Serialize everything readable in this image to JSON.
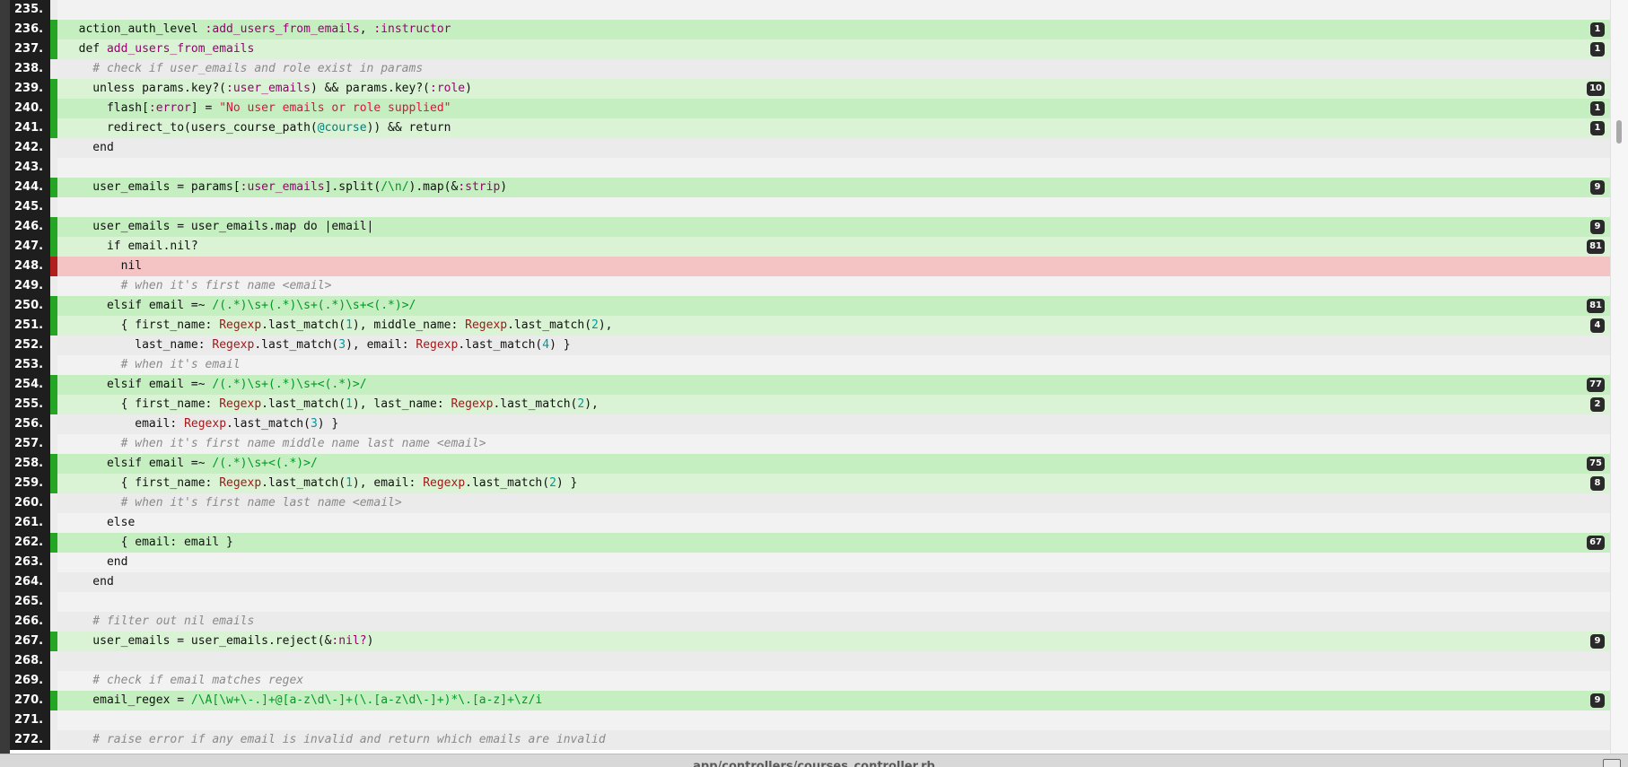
{
  "file": {
    "path": "app/controllers/courses_controller.rb"
  },
  "colors": {
    "covered_mark": "#24a624",
    "missed_mark": "#b01e1e",
    "covered_bg": "#d9f3d4",
    "missed_bg": "#f4c3c3",
    "gutter_bg": "#1e1e1e"
  },
  "lines": [
    {
      "num": "235.",
      "status": "never",
      "hits": null,
      "tokens": []
    },
    {
      "num": "236.",
      "status": "covered",
      "hits": "1",
      "tokens": [
        [
          "",
          "  action_auth_level "
        ],
        [
          "sym",
          ":add_users_from_emails"
        ],
        [
          "",
          ", "
        ],
        [
          "sym",
          ":instructor"
        ]
      ]
    },
    {
      "num": "237.",
      "status": "covered",
      "hits": "1",
      "tokens": [
        [
          "",
          "  def "
        ],
        [
          "sym",
          "add_users_from_emails"
        ]
      ]
    },
    {
      "num": "238.",
      "status": "never",
      "hits": null,
      "tokens": [
        [
          "com",
          "    # check if user_emails and role exist in params"
        ]
      ]
    },
    {
      "num": "239.",
      "status": "covered",
      "hits": "10",
      "tokens": [
        [
          "",
          "    unless params.key?("
        ],
        [
          "sym",
          ":user_emails"
        ],
        [
          "",
          ") && params.key?("
        ],
        [
          "sym",
          ":role"
        ],
        [
          "",
          ")"
        ]
      ]
    },
    {
      "num": "240.",
      "status": "covered",
      "hits": "1",
      "tokens": [
        [
          "",
          "      flash["
        ],
        [
          "sym",
          ":error"
        ],
        [
          "",
          "] = "
        ],
        [
          "str",
          "\"No user emails or role supplied\""
        ]
      ]
    },
    {
      "num": "241.",
      "status": "covered",
      "hits": "1",
      "tokens": [
        [
          "",
          "      redirect_to(users_course_path("
        ],
        [
          "ivar",
          "@course"
        ],
        [
          "",
          "))"
        ],
        [
          "",
          " && return"
        ]
      ]
    },
    {
      "num": "242.",
      "status": "never",
      "hits": null,
      "tokens": [
        [
          "",
          "    end"
        ]
      ]
    },
    {
      "num": "243.",
      "status": "never",
      "hits": null,
      "tokens": []
    },
    {
      "num": "244.",
      "status": "covered",
      "hits": "9",
      "tokens": [
        [
          "",
          "    user_emails = params["
        ],
        [
          "sym",
          ":user_emails"
        ],
        [
          "",
          "].split("
        ],
        [
          "re",
          "/\\n/"
        ],
        [
          "",
          ").map(&"
        ],
        [
          "sym",
          ":strip"
        ],
        [
          "",
          ")"
        ]
      ]
    },
    {
      "num": "245.",
      "status": "never",
      "hits": null,
      "tokens": []
    },
    {
      "num": "246.",
      "status": "covered",
      "hits": "9",
      "tokens": [
        [
          "",
          "    user_emails = user_emails.map do |email|"
        ]
      ]
    },
    {
      "num": "247.",
      "status": "covered",
      "hits": "81",
      "tokens": [
        [
          "",
          "      if email.nil?"
        ]
      ]
    },
    {
      "num": "248.",
      "status": "missed",
      "hits": null,
      "tokens": [
        [
          "",
          "        nil"
        ]
      ]
    },
    {
      "num": "249.",
      "status": "never",
      "hits": null,
      "tokens": [
        [
          "com",
          "        # when it's first name <email>"
        ]
      ]
    },
    {
      "num": "250.",
      "status": "covered",
      "hits": "81",
      "tokens": [
        [
          "",
          "      elsif email =~ "
        ],
        [
          "re",
          "/(.*)\\s+(.*)\\s+(.*)\\s+<(.*)>/"
        ]
      ]
    },
    {
      "num": "251.",
      "status": "covered",
      "hits": "4",
      "tokens": [
        [
          "",
          "        { first_name: "
        ],
        [
          "const",
          "Regexp"
        ],
        [
          "",
          ".last_match("
        ],
        [
          "num",
          "1"
        ],
        [
          "",
          "), middle_name: "
        ],
        [
          "const",
          "Regexp"
        ],
        [
          "",
          ".last_match("
        ],
        [
          "num",
          "2"
        ],
        [
          "",
          "),"
        ]
      ]
    },
    {
      "num": "252.",
      "status": "never",
      "hits": null,
      "tokens": [
        [
          "",
          "          last_name: "
        ],
        [
          "const",
          "Regexp"
        ],
        [
          "",
          ".last_match("
        ],
        [
          "num",
          "3"
        ],
        [
          "",
          "), email: "
        ],
        [
          "const",
          "Regexp"
        ],
        [
          "",
          ".last_match("
        ],
        [
          "num",
          "4"
        ],
        [
          "",
          ") }"
        ]
      ]
    },
    {
      "num": "253.",
      "status": "never",
      "hits": null,
      "tokens": [
        [
          "com",
          "        # when it's email"
        ]
      ]
    },
    {
      "num": "254.",
      "status": "covered",
      "hits": "77",
      "tokens": [
        [
          "",
          "      elsif email =~ "
        ],
        [
          "re",
          "/(.*)\\s+(.*)\\s+<(.*)>/"
        ]
      ]
    },
    {
      "num": "255.",
      "status": "covered",
      "hits": "2",
      "tokens": [
        [
          "",
          "        { first_name: "
        ],
        [
          "const",
          "Regexp"
        ],
        [
          "",
          ".last_match("
        ],
        [
          "num",
          "1"
        ],
        [
          "",
          "), last_name: "
        ],
        [
          "const",
          "Regexp"
        ],
        [
          "",
          ".last_match("
        ],
        [
          "num",
          "2"
        ],
        [
          "",
          "),"
        ]
      ]
    },
    {
      "num": "256.",
      "status": "never",
      "hits": null,
      "tokens": [
        [
          "",
          "          email: "
        ],
        [
          "const",
          "Regexp"
        ],
        [
          "",
          ".last_match("
        ],
        [
          "num",
          "3"
        ],
        [
          "",
          ") }"
        ]
      ]
    },
    {
      "num": "257.",
      "status": "never",
      "hits": null,
      "tokens": [
        [
          "com",
          "        # when it's first name middle name last name <email>"
        ]
      ]
    },
    {
      "num": "258.",
      "status": "covered",
      "hits": "75",
      "tokens": [
        [
          "",
          "      elsif email =~ "
        ],
        [
          "re",
          "/(.*)\\s+<(.*)>/"
        ]
      ]
    },
    {
      "num": "259.",
      "status": "covered",
      "hits": "8",
      "tokens": [
        [
          "",
          "        { first_name: "
        ],
        [
          "const",
          "Regexp"
        ],
        [
          "",
          ".last_match("
        ],
        [
          "num",
          "1"
        ],
        [
          "",
          "), email: "
        ],
        [
          "const",
          "Regexp"
        ],
        [
          "",
          ".last_match("
        ],
        [
          "num",
          "2"
        ],
        [
          "",
          ") }"
        ]
      ]
    },
    {
      "num": "260.",
      "status": "never",
      "hits": null,
      "tokens": [
        [
          "com",
          "        # when it's first name last name <email>"
        ]
      ]
    },
    {
      "num": "261.",
      "status": "never",
      "hits": null,
      "tokens": [
        [
          "",
          "      else"
        ]
      ]
    },
    {
      "num": "262.",
      "status": "covered",
      "hits": "67",
      "tokens": [
        [
          "",
          "        { email: email }"
        ]
      ]
    },
    {
      "num": "263.",
      "status": "never",
      "hits": null,
      "tokens": [
        [
          "",
          "      end"
        ]
      ]
    },
    {
      "num": "264.",
      "status": "never",
      "hits": null,
      "tokens": [
        [
          "",
          "    end"
        ]
      ]
    },
    {
      "num": "265.",
      "status": "never",
      "hits": null,
      "tokens": []
    },
    {
      "num": "266.",
      "status": "never",
      "hits": null,
      "tokens": [
        [
          "com",
          "    # filter out nil emails"
        ]
      ]
    },
    {
      "num": "267.",
      "status": "covered",
      "hits": "9",
      "tokens": [
        [
          "",
          "    user_emails = user_emails.reject(&"
        ],
        [
          "sym",
          ":nil?"
        ],
        [
          "",
          ")"
        ]
      ]
    },
    {
      "num": "268.",
      "status": "never",
      "hits": null,
      "tokens": []
    },
    {
      "num": "269.",
      "status": "never",
      "hits": null,
      "tokens": [
        [
          "com",
          "    # check if email matches regex"
        ]
      ]
    },
    {
      "num": "270.",
      "status": "covered",
      "hits": "9",
      "tokens": [
        [
          "",
          "    email_regex = "
        ],
        [
          "re",
          "/\\A[\\w+\\-.]+@[a-z\\d\\-]+(\\.[a-z\\d\\-]+)*\\.[a-z]+\\z/i"
        ]
      ]
    },
    {
      "num": "271.",
      "status": "never",
      "hits": null,
      "tokens": []
    },
    {
      "num": "272.",
      "status": "never",
      "hits": null,
      "tokens": [
        [
          "com",
          "    # raise error if any email is invalid and return which emails are invalid"
        ]
      ]
    }
  ]
}
